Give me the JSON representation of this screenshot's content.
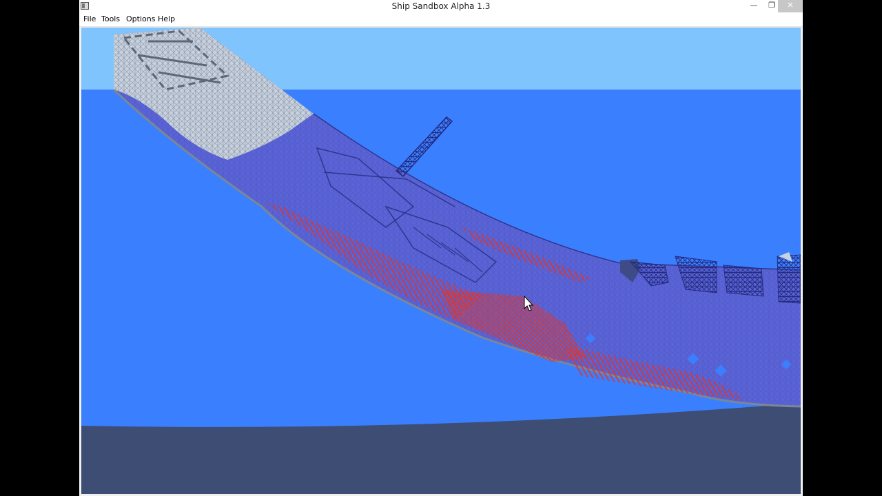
{
  "window": {
    "title": "Ship Sandbox Alpha 1.3",
    "icon": "app-window-icon",
    "controls": {
      "minimize": "—",
      "restore": "❐",
      "close": "✕"
    }
  },
  "menu": {
    "items": [
      {
        "id": "file",
        "label": "File"
      },
      {
        "id": "tools",
        "label": "Tools"
      },
      {
        "id": "options",
        "label": "Options"
      },
      {
        "id": "help",
        "label": "Help"
      }
    ]
  },
  "scene": {
    "colors": {
      "sky": "#7fc4fc",
      "water": "#3a80fe",
      "seabed": "#3e4d74",
      "hull": "#5b64d6",
      "structure_dark": "#2e3590",
      "stress": "#e23327",
      "dry_hull": "#c8d1de",
      "dry_lines": "#7b8797"
    }
  }
}
